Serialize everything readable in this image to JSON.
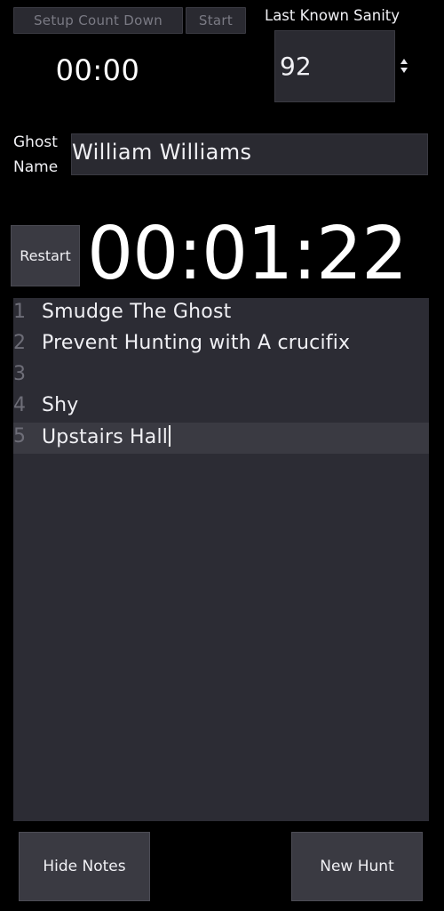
{
  "timer_controls": {
    "setup_label": "Setup Count Down",
    "start_label": "Start",
    "countdown": "00:00"
  },
  "sanity": {
    "label": "Last Known Sanity",
    "value": "92",
    "stepper_icon": "up-down-stepper-icon"
  },
  "ghost": {
    "label_line1": "Ghost",
    "label_line2": "Name",
    "name": "William Williams"
  },
  "hunt_timer": {
    "restart_label": "Restart",
    "elapsed": "00:01:22"
  },
  "notes": {
    "lines": [
      {
        "number": "1",
        "text": "Smudge The Ghost"
      },
      {
        "number": "2",
        "text": "Prevent Hunting with A crucifix"
      },
      {
        "number": "3",
        "text": ""
      },
      {
        "number": "4",
        "text": "Shy"
      },
      {
        "number": "5",
        "text": "Upstairs Hall"
      }
    ]
  },
  "footer": {
    "hide_notes_label": "Hide Notes",
    "new_hunt_label": "New Hunt"
  },
  "colors": {
    "background": "#000000",
    "panel": "#2c2c34",
    "button": "#3a3a42",
    "text": "#f0f0f4"
  }
}
